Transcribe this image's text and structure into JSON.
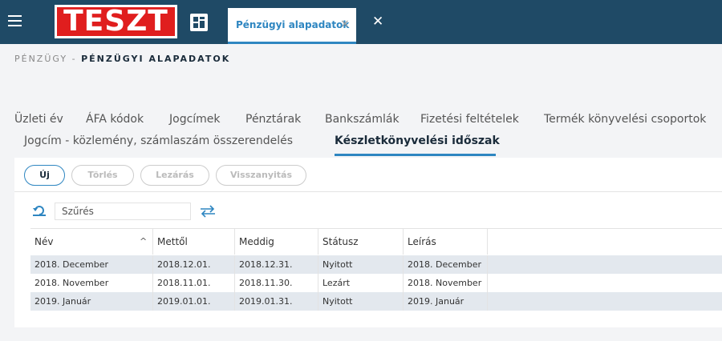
{
  "header": {
    "logo_text": "TESZT",
    "active_tab": "Pénzügyi alapadatok",
    "tab_close": "×",
    "close_all": "✕"
  },
  "breadcrumb": {
    "root": "PÉNZÜGY",
    "sep": " - ",
    "current": "PÉNZÜGYI ALAPADATOK"
  },
  "tabs": [
    "Üzleti év",
    "ÁFA kódok",
    "Jogcímek",
    "Pénztárak",
    "Bankszámlák",
    "Fizetési feltételek",
    "Termék könyvelési csoportok",
    "Jogcím - közlemény, számlaszám összerendelés",
    "Készletkönyvelési időszak"
  ],
  "toolbar": {
    "new": "Új",
    "delete": "Törlés",
    "close": "Lezárás",
    "reopen": "Visszanyitás"
  },
  "filter": {
    "placeholder": "Szűrés"
  },
  "table": {
    "sort_indicator": "^",
    "columns": [
      "Név",
      "Mettől",
      "Meddig",
      "Státusz",
      "Leírás"
    ],
    "rows": [
      [
        "2018. December",
        "2018.12.01.",
        "2018.12.31.",
        "Nyitott",
        "2018. December"
      ],
      [
        "2018. November",
        "2018.11.01.",
        "2018.11.30.",
        "Lezárt",
        "2018. November"
      ],
      [
        "2019. Január",
        "2019.01.01.",
        "2019.01.31.",
        "Nyitott",
        "2019. Január"
      ]
    ]
  },
  "colors": {
    "header_bg": "#1f4a66",
    "accent": "#2e86c1",
    "logo_red": "#e01e1e"
  }
}
